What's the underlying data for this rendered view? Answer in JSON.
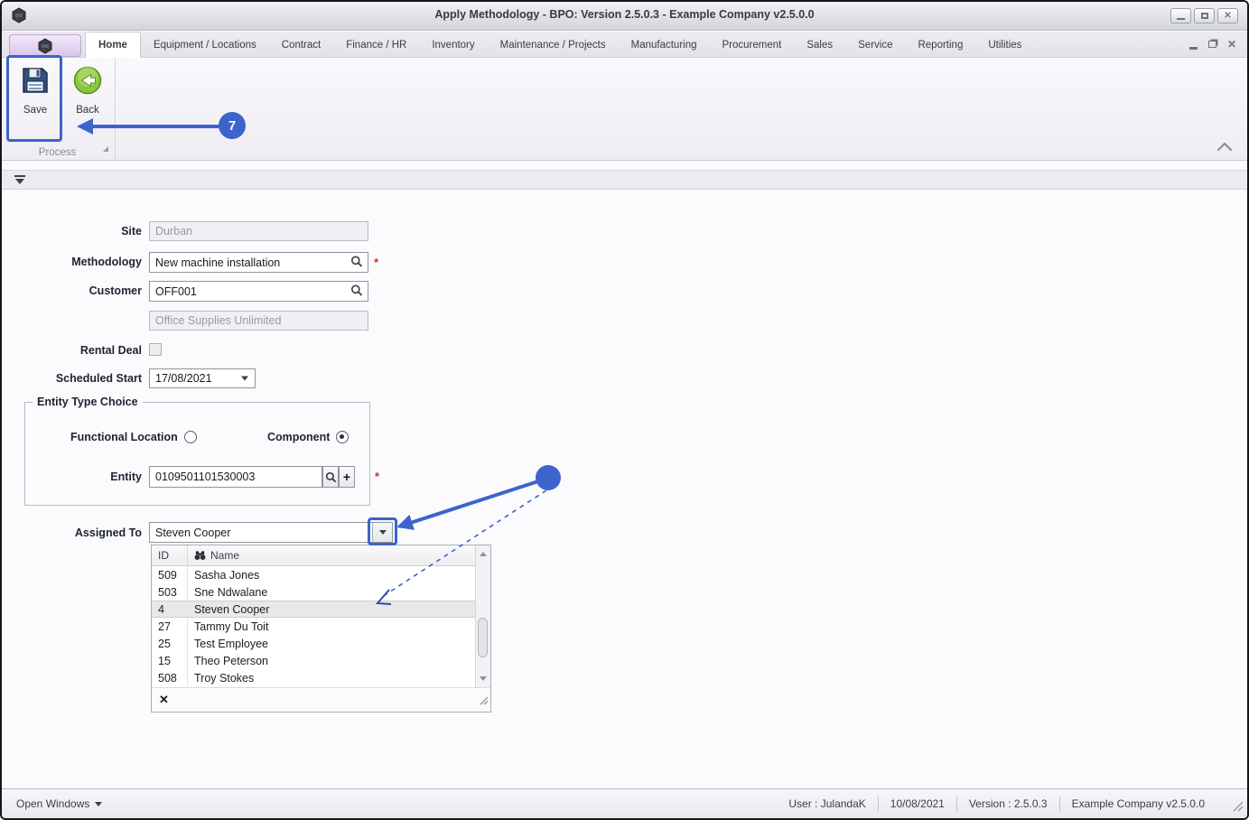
{
  "window": {
    "title": "Apply Methodology - BPO: Version 2.5.0.3 - Example Company v2.5.0.0"
  },
  "ribbon": {
    "tabs": [
      "Home",
      "Equipment / Locations",
      "Contract",
      "Finance / HR",
      "Inventory",
      "Maintenance / Projects",
      "Manufacturing",
      "Procurement",
      "Sales",
      "Service",
      "Reporting",
      "Utilities"
    ],
    "active_tab": "Home",
    "save_label": "Save",
    "back_label": "Back",
    "group_label": "Process"
  },
  "form": {
    "site": {
      "label": "Site",
      "value": "Durban"
    },
    "methodology": {
      "label": "Methodology",
      "value": "New machine installation",
      "required": "*"
    },
    "customer": {
      "label": "Customer",
      "value": "OFF001"
    },
    "customer_name": {
      "value": "Office Supplies Unlimited"
    },
    "rental_deal": {
      "label": "Rental Deal"
    },
    "scheduled_start": {
      "label": "Scheduled Start",
      "value": "17/08/2021"
    },
    "entity_type": {
      "legend": "Entity Type Choice",
      "option_functional": "Functional Location",
      "option_component": "Component",
      "selected": "Component"
    },
    "entity": {
      "label": "Entity",
      "value": "0109501101530003",
      "required": "*",
      "add_label": "+"
    },
    "assigned_to": {
      "label": "Assigned To",
      "value": "Steven Cooper"
    }
  },
  "dropdown": {
    "columns": {
      "id": "ID",
      "name": "Name"
    },
    "rows": [
      {
        "id": "509",
        "name": "Sasha Jones"
      },
      {
        "id": "503",
        "name": "Sne Ndwalane"
      },
      {
        "id": "4",
        "name": "Steven Cooper"
      },
      {
        "id": "27",
        "name": "Tammy Du Toit"
      },
      {
        "id": "25",
        "name": "Test Employee"
      },
      {
        "id": "15",
        "name": "Theo Peterson"
      },
      {
        "id": "508",
        "name": "Troy Stokes"
      }
    ],
    "selected_name": "Steven Cooper"
  },
  "statusbar": {
    "open_windows": "Open Windows",
    "user": "User : JulandaK",
    "date": "10/08/2021",
    "version": "Version : 2.5.0.3",
    "company": "Example Company v2.5.0.0"
  },
  "annotations": {
    "step_number": "7"
  },
  "icons": {
    "close_glyph": "✕",
    "clear_glyph": "✕"
  },
  "colors": {
    "annotation_blue": "#3d64cb",
    "required_red": "#d22f2f",
    "back_green": "#76b82a",
    "save_navy": "#33517a"
  }
}
